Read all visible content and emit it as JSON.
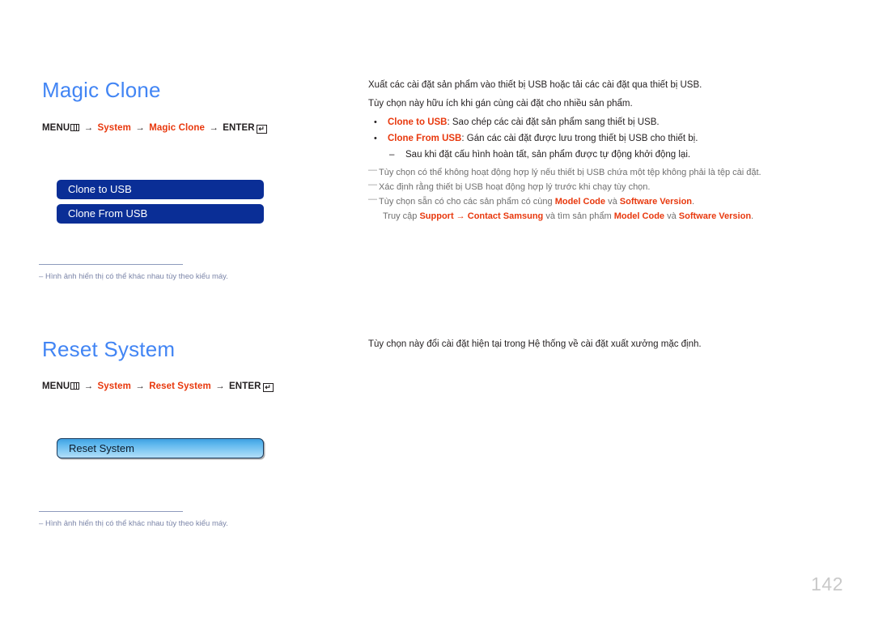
{
  "page": {
    "number": "142",
    "accent_blue": "#4285f4",
    "accent_red": "#e8380d",
    "osd_navy": "#0a2e96"
  },
  "sections": [
    {
      "title": "Magic Clone",
      "menu_path": {
        "menu_label": "MENU",
        "menu_icon": "menu-grid-icon",
        "arrow": "→",
        "step1": "System",
        "step2": "Magic Clone",
        "enter_label": "ENTER",
        "enter_icon": "enter-return-icon",
        "enter_glyph": "↵"
      },
      "osd_items": [
        {
          "label": "Clone to USB",
          "selected": false
        },
        {
          "label": "Clone From USB",
          "selected": false
        }
      ],
      "footnote": {
        "dash": "–",
        "text": "Hình ảnh hiển thị có thể khác nhau tùy theo kiểu máy."
      },
      "body": {
        "paragraphs": [
          "Xuất các cài đặt sản phẩm vào thiết bị USB hoặc tải các cài đặt qua thiết bị USB.",
          "Tùy chọn này hữu ích khi gán cùng cài đặt cho nhiều sản phẩm."
        ],
        "bullets": [
          {
            "marker": "•",
            "keyword": "Clone to USB",
            "rest": ": Sao chép các cài đặt sản phẩm sang thiết bị USB."
          },
          {
            "marker": "•",
            "keyword": "Clone From USB",
            "rest": ": Gán các cài đặt được lưu trong thiết bị USB cho thiết bị."
          }
        ],
        "sub_bullets": [
          {
            "marker": "–",
            "text": "Sau khi đặt cấu hình hoàn tất, sản phẩm được tự động khởi động lại."
          }
        ],
        "notes": [
          {
            "marker": "—",
            "text": "Tùy chọn có thể không hoạt động hợp lý nếu thiết bị USB chứa một tệp không phải là tệp cài đặt."
          },
          {
            "marker": "—",
            "text": "Xác định rằng thiết bị USB hoạt động hợp lý trước khi chạy tùy chọn."
          }
        ],
        "note_model": {
          "marker": "—",
          "pre": "Tùy chọn sẵn có cho các sản phẩm có cùng ",
          "kw1": "Model Code",
          "mid": " và ",
          "kw2": "Software Version",
          "post": ".",
          "line2_pre": "Truy cập ",
          "line2_kw1": "Support",
          "line2_arrow": " → ",
          "line2_kw2": "Contact Samsung",
          "line2_mid": " và tìm sản phẩm ",
          "line2_kw3": "Model Code",
          "line2_mid2": " và ",
          "line2_kw4": "Software Version",
          "line2_post": "."
        }
      }
    },
    {
      "title": "Reset System",
      "menu_path": {
        "menu_label": "MENU",
        "menu_icon": "menu-grid-icon",
        "arrow": "→",
        "step1": "System",
        "step2": "Reset System",
        "enter_label": "ENTER",
        "enter_icon": "enter-return-icon",
        "enter_glyph": "↵"
      },
      "osd_items": [
        {
          "label": "Reset System",
          "selected": true
        }
      ],
      "footnote": {
        "dash": "–",
        "text": "Hình ảnh hiển thị có thể khác nhau tùy theo kiểu máy."
      },
      "body": {
        "paragraphs": [
          "Tùy chọn này đổi cài đặt hiện tại trong Hệ thống về cài đặt xuất xưởng mặc định."
        ]
      }
    }
  ]
}
